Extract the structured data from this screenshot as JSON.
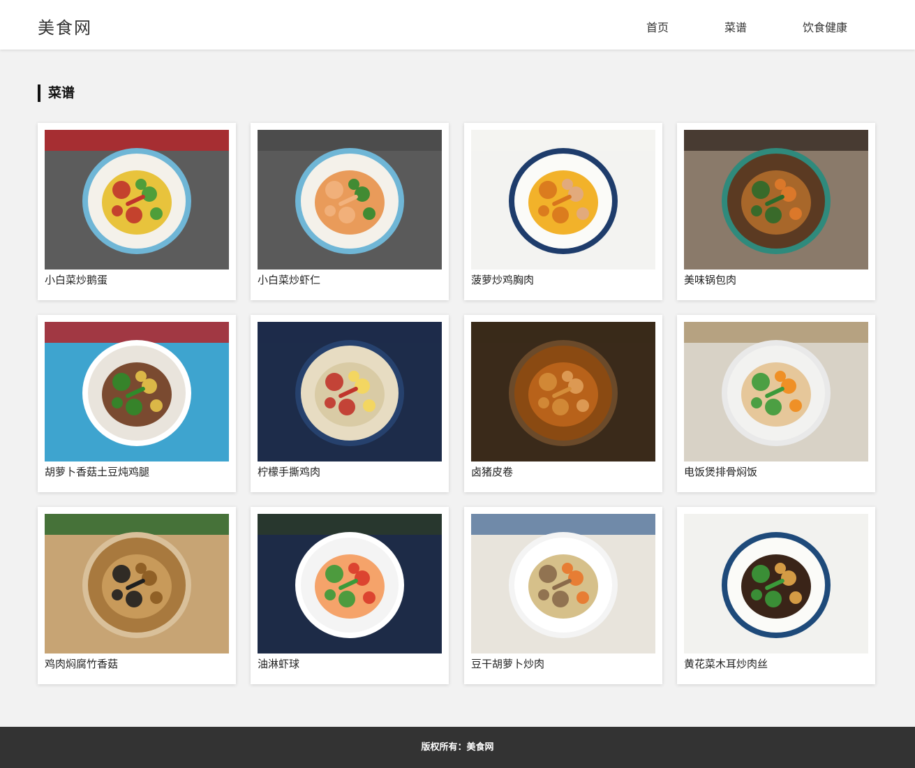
{
  "header": {
    "logo": "美食网",
    "nav": [
      {
        "label": "首页"
      },
      {
        "label": "菜谱"
      },
      {
        "label": "饮食健康"
      }
    ]
  },
  "main": {
    "section_title": "菜谱",
    "recipes": [
      {
        "title": "小白菜炒鹅蛋",
        "image": {
          "bg": "#5c5c5c",
          "rim": "#6fb6d6",
          "plate": "#f4f1ea",
          "food": "#e8c33c",
          "accent": "#3e9a3a",
          "accent2": "#c0342b",
          "top": "#b3262a"
        }
      },
      {
        "title": "小白菜炒虾仁",
        "image": {
          "bg": "#5a5a5a",
          "rim": "#6fb6d6",
          "plate": "#f4f1ea",
          "food": "#e99b5a",
          "accent": "#2f8a2f",
          "accent2": "#f2b27d",
          "top": "#4a4a4a"
        }
      },
      {
        "title": "菠萝炒鸡胸肉",
        "image": {
          "bg": "#f3f3f1",
          "rim": "#1e3c6b",
          "plate": "#fbfbf8",
          "food": "#f2b22a",
          "accent": "#e0a985",
          "accent2": "#d8751d",
          "top": "#f3f3f1"
        }
      },
      {
        "title": "美味锅包肉",
        "image": {
          "bg": "#8a7a6a",
          "rim": "#2f8a7c",
          "plate": "#5b3a22",
          "food": "#a8672a",
          "accent": "#e07a2a",
          "accent2": "#2c6a2a",
          "top": "#3c3028"
        }
      },
      {
        "title": "胡萝卜香菇土豆炖鸡腿",
        "image": {
          "bg": "#3ea4cf",
          "rim": "#ffffff",
          "plate": "#e9e4dc",
          "food": "#7a4a30",
          "accent": "#e5c34a",
          "accent2": "#2f8a2a",
          "top": "#b3262a"
        }
      },
      {
        "title": "柠檬手撕鸡肉",
        "image": {
          "bg": "#1d2c4a",
          "rim": "#26416d",
          "plate": "#e7dcc2",
          "food": "#d9cba5",
          "accent": "#f5d75a",
          "accent2": "#c0342b",
          "top": "#1d2c4a"
        }
      },
      {
        "title": "卤猪皮卷",
        "image": {
          "bg": "#3a2a1a",
          "rim": "#6b4a2a",
          "plate": "#8a4a12",
          "food": "#b8621a",
          "accent": "#e0a05a",
          "accent2": "#d48d3a",
          "top": "#3a2a1a"
        }
      },
      {
        "title": "电饭煲排骨焖饭",
        "image": {
          "bg": "#d8d2c6",
          "rim": "#e9e9e9",
          "plate": "#f2f2f0",
          "food": "#e6c79a",
          "accent": "#f08a1a",
          "accent2": "#3b9a3a",
          "top": "#b09a74"
        }
      },
      {
        "title": "鸡肉焖腐竹香菇",
        "image": {
          "bg": "#c7a474",
          "rim": "#d9c09a",
          "plate": "#a8793e",
          "food": "#c89a5a",
          "accent": "#8a5a20",
          "accent2": "#1f1f1f",
          "top": "#2f6a2f"
        }
      },
      {
        "title": "油淋虾球",
        "image": {
          "bg": "#1d2b47",
          "rim": "#ffffff",
          "plate": "#f4f4f4",
          "food": "#f5a36a",
          "accent": "#d93a2a",
          "accent2": "#3b9a3a",
          "top": "#2a3a2a"
        }
      },
      {
        "title": "豆干胡萝卜炒肉",
        "image": {
          "bg": "#e8e4dc",
          "rim": "#f4f4f4",
          "plate": "#ffffff",
          "food": "#d6c08a",
          "accent": "#e9762a",
          "accent2": "#8a6a4a",
          "top": "#5a7aa0"
        }
      },
      {
        "title": "黄花菜木耳炒肉丝",
        "image": {
          "bg": "#f2f2ef",
          "rim": "#1e4a7a",
          "plate": "#fbfbf8",
          "food": "#3a2418",
          "accent": "#e6a84a",
          "accent2": "#3b9a3a",
          "top": "#f2f2ef"
        }
      }
    ]
  },
  "footer": {
    "copyright": "版权所有：美食网"
  }
}
